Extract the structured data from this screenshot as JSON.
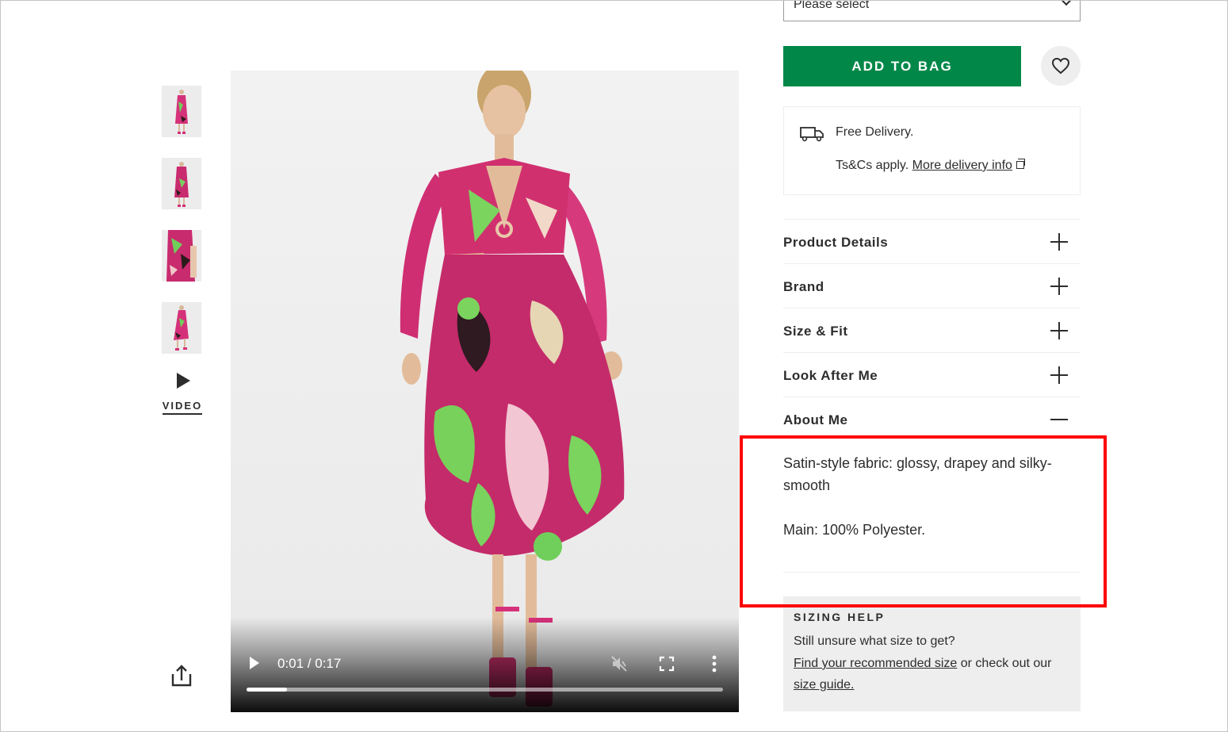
{
  "gallery": {
    "thumbnails": [
      {
        "alt": "Product image 1 - front view"
      },
      {
        "alt": "Product image 2 - front pose"
      },
      {
        "alt": "Product image 3 - close-up"
      },
      {
        "alt": "Product image 4 - side view"
      }
    ],
    "video_label": "VIDEO",
    "video_icon": "play-icon",
    "share_icon": "share-icon"
  },
  "video_player": {
    "time_display": "0:01 / 0:17",
    "current_time": "0:01",
    "duration": "0:17",
    "progress_fraction": 0.085,
    "muted": true,
    "icons": [
      "play-icon",
      "mute-icon",
      "fullscreen-icon",
      "more-options-icon"
    ]
  },
  "product": {
    "size_select": {
      "placeholder": "Please select"
    },
    "add_to_bag_label": "ADD TO BAG",
    "wishlist_icon": "heart-icon",
    "brand_color": "#018849"
  },
  "delivery": {
    "icon": "truck-icon",
    "title": "Free Delivery.",
    "terms_prefix": "Ts&Cs apply.",
    "link_label": "More delivery info",
    "link_icon": "external-link-icon"
  },
  "accordion": {
    "items": [
      {
        "label": "Product Details",
        "expanded": false
      },
      {
        "label": "Brand",
        "expanded": false
      },
      {
        "label": "Size & Fit",
        "expanded": false
      },
      {
        "label": "Look After Me",
        "expanded": false
      },
      {
        "label": "About Me",
        "expanded": true
      }
    ],
    "about_me": {
      "paragraphs": [
        "Satin-style fabric: glossy, drapey and silky-smooth",
        "Main: 100% Polyester."
      ]
    }
  },
  "sizing_help": {
    "title": "SIZING HELP",
    "question": "Still unsure what size to get?",
    "recommend_link": "Find your recommended size",
    "middle_text": " or check out our",
    "guide_link": "size guide."
  },
  "annotation": {
    "highlight_color": "#ff0000",
    "highlight_target": "About Me content"
  }
}
